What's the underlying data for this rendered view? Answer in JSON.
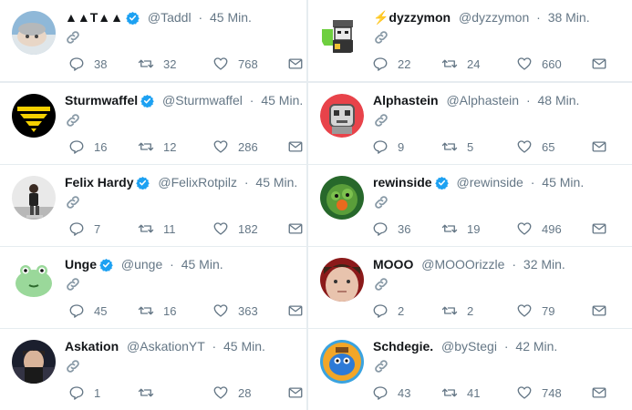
{
  "icons": {
    "reply": "reply-icon",
    "retweet": "retweet-icon",
    "like": "heart-icon",
    "dm": "envelope-icon",
    "link": "link-icon",
    "verified": "verified-badge-icon"
  },
  "colors": {
    "verified": "#1da1f2",
    "muted": "#657786",
    "border": "#e6ecf0"
  },
  "tweets": [
    {
      "name": "▲▲T▲▲",
      "handle": "@Taddl",
      "time": "45 Min.",
      "verified": true,
      "replies": "38",
      "retweets": "32",
      "likes": "768"
    },
    {
      "name": "⚡dyzzymon",
      "handle": "@dyzzymon",
      "time": "38 Min.",
      "verified": false,
      "replies": "22",
      "retweets": "24",
      "likes": "660"
    },
    {
      "name": "Sturmwaffel",
      "handle": "@Sturmwaffel",
      "time": "45 Min.",
      "verified": true,
      "replies": "16",
      "retweets": "12",
      "likes": "286"
    },
    {
      "name": "Alphastein",
      "handle": "@Alphastein",
      "time": "48 Min.",
      "verified": false,
      "replies": "9",
      "retweets": "5",
      "likes": "65"
    },
    {
      "name": "Felix Hardy",
      "handle": "@FelixRotpilz",
      "time": "45 Min.",
      "verified": true,
      "replies": "7",
      "retweets": "11",
      "likes": "182"
    },
    {
      "name": "rewinside",
      "handle": "@rewinside",
      "time": "45 Min.",
      "verified": true,
      "replies": "36",
      "retweets": "19",
      "likes": "496"
    },
    {
      "name": "Unge",
      "handle": "@unge",
      "time": "45 Min.",
      "verified": true,
      "replies": "45",
      "retweets": "16",
      "likes": "363"
    },
    {
      "name": "MOOO",
      "handle": "@MOOOrizzle",
      "time": "32 Min.",
      "verified": false,
      "replies": "2",
      "retweets": "2",
      "likes": "79"
    },
    {
      "name": "Askation",
      "handle": "@AskationYT",
      "time": "45 Min.",
      "verified": false,
      "replies": "1",
      "retweets": "",
      "likes": "28"
    },
    {
      "name": "Schdegie.",
      "handle": "@byStegi",
      "time": "42 Min.",
      "verified": false,
      "replies": "43",
      "retweets": "41",
      "likes": "748"
    }
  ]
}
